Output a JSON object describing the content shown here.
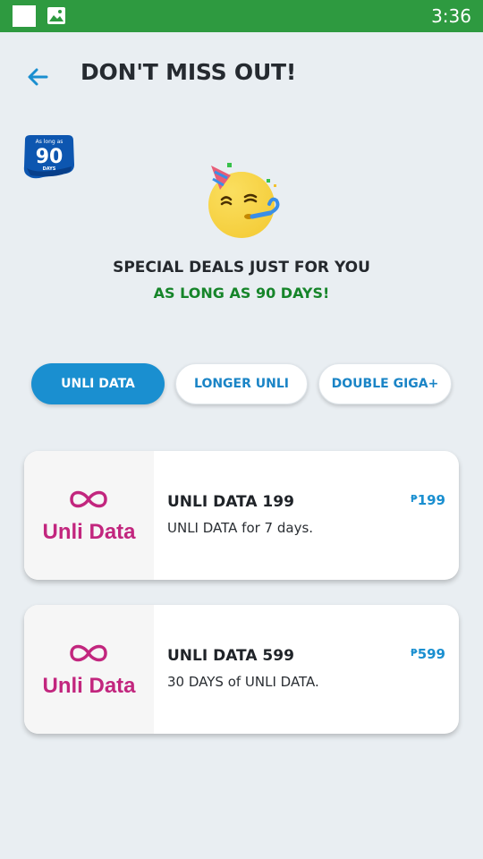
{
  "status_bar": {
    "time": "3:36"
  },
  "header": {
    "title": "DON'T MISS OUT!"
  },
  "badge": {
    "line1": "As long as",
    "number": "90",
    "line2": "DAYS"
  },
  "promo": {
    "headline": "SPECIAL DEALS JUST FOR YOU",
    "subline": "AS LONG AS 90 DAYS!"
  },
  "tabs": [
    {
      "label": "UNLI DATA",
      "active": true
    },
    {
      "label": "LONGER UNLI",
      "active": false
    },
    {
      "label": "DOUBLE GIGA+",
      "active": false
    }
  ],
  "offers": [
    {
      "brand": "Unli Data",
      "title": "UNLI DATA 199",
      "description": "UNLI DATA for 7 days.",
      "currency": "₱",
      "price": "199"
    },
    {
      "brand": "Unli Data",
      "title": "UNLI DATA 599",
      "description": "30 DAYS of UNLI DATA.",
      "currency": "₱",
      "price": "599"
    }
  ],
  "colors": {
    "status_bar": "#2e9a40",
    "accent_blue": "#1a8fd0",
    "green_text": "#16852a",
    "brand_magenta": "#c2267e",
    "background": "#e9eef2"
  },
  "icons": {
    "back": "arrow-left-icon",
    "status_left": "square-icon",
    "status_image": "image-icon",
    "emoji": "partying-face-icon",
    "offer_logo": "infinity-icon"
  }
}
